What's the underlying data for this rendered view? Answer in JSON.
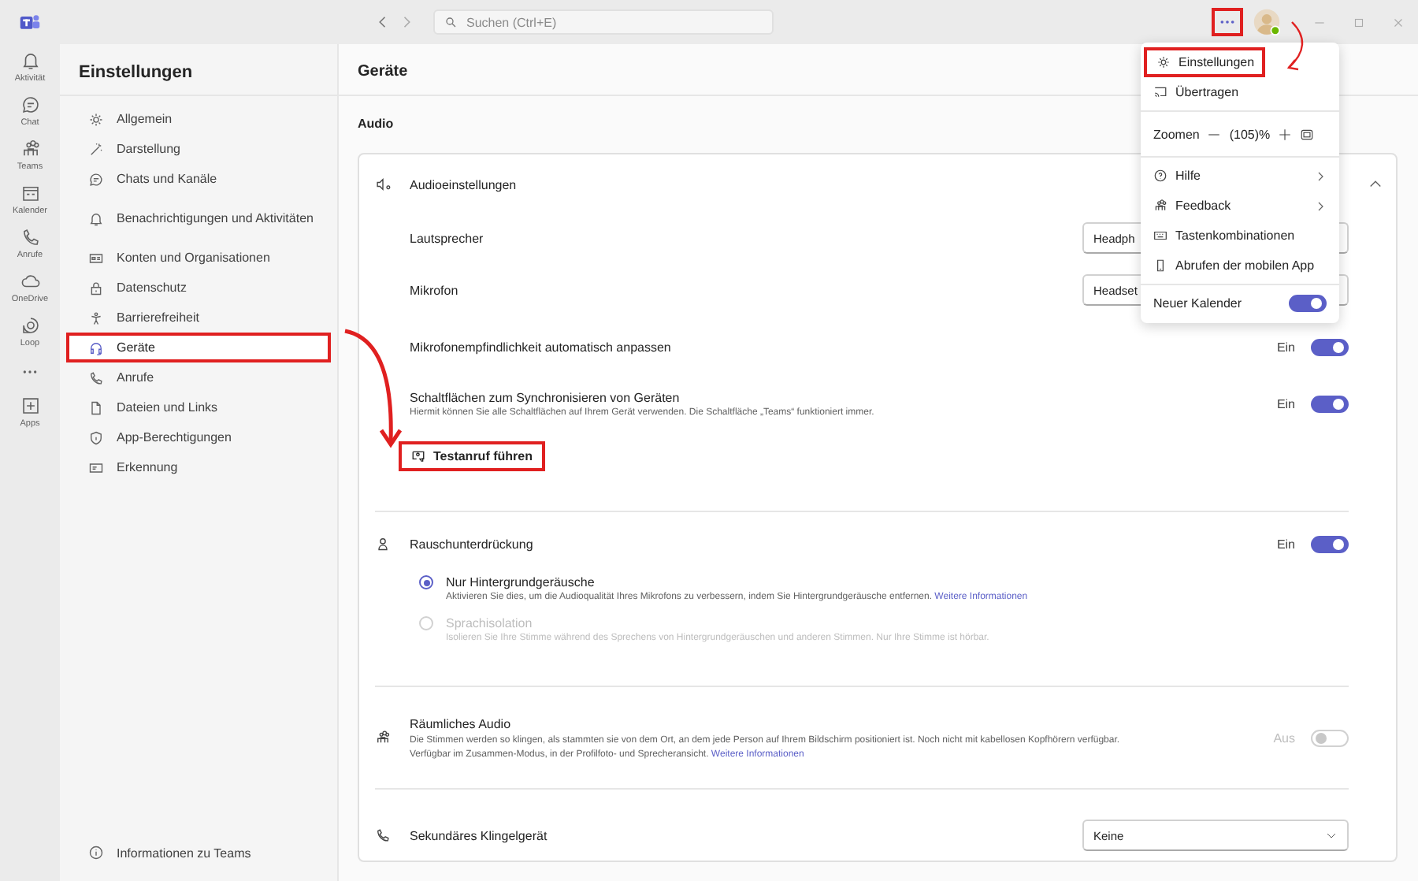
{
  "top_bar": {
    "search": {
      "placeholder": "Suchen (Ctrl+E)"
    },
    "more_button": {
      "highlighted": true
    }
  },
  "app_bar": {
    "items": [
      {
        "kind": "nav",
        "label": "Aktivität"
      },
      {
        "kind": "nav",
        "label": "Chat"
      },
      {
        "kind": "nav",
        "label": "Teams"
      },
      {
        "kind": "nav",
        "label": "Kalender"
      },
      {
        "kind": "nav",
        "label": "Anrufe"
      },
      {
        "kind": "nav",
        "label": "OneDrive"
      },
      {
        "kind": "nav",
        "label": "Loop"
      },
      {
        "kind": "more"
      },
      {
        "kind": "nav",
        "label": "Apps"
      }
    ]
  },
  "settings": {
    "title": "Einstellungen",
    "groups": [
      [
        {
          "label": "Allgemein",
          "selected": false,
          "highlighted": false
        },
        {
          "label": "Darstellung",
          "selected": false,
          "highlighted": false
        },
        {
          "label": "Chats und Kanäle",
          "selected": false,
          "highlighted": false
        }
      ],
      [
        {
          "label": "Benachrichtigungen und Aktivitäten",
          "selected": false,
          "highlighted": false
        }
      ],
      [
        {
          "label": "Konten und Organisationen",
          "selected": false,
          "highlighted": false
        },
        {
          "label": "Datenschutz",
          "selected": false,
          "highlighted": false
        },
        {
          "label": "Barrierefreiheit",
          "selected": false,
          "highlighted": false
        },
        {
          "label": "Geräte",
          "selected": true,
          "highlighted": true
        },
        {
          "label": "Anrufe",
          "selected": false,
          "highlighted": false
        },
        {
          "label": "Dateien und Links",
          "selected": false,
          "highlighted": false
        },
        {
          "label": "App-Berechtigungen",
          "selected": false,
          "highlighted": false
        },
        {
          "label": "Erkennung",
          "selected": false,
          "highlighted": false
        }
      ]
    ],
    "footer": "Informationen zu Teams"
  },
  "page": {
    "title": "Geräte",
    "section": "Audio",
    "audio_settings": {
      "title": "Audioeinstellungen",
      "expanded": true,
      "rows": [
        {
          "kind": "select",
          "label": "Lautsprecher",
          "value": "Headph"
        },
        {
          "kind": "select",
          "label": "Mikrofon",
          "value": "Headset"
        },
        {
          "kind": "toggle",
          "label": "Mikrofonempfindlichkeit automatisch anpassen",
          "state_label": "Ein",
          "on": true
        },
        {
          "kind": "toggle",
          "label": "Schaltflächen zum Synchronisieren von Geräten",
          "description": "Hiermit können Sie alle Schaltflächen auf Ihrem Gerät verwenden. Die Schaltfläche „Teams“ funktioniert immer.",
          "state_label": "Ein",
          "on": true
        }
      ],
      "test_call": {
        "label": "Testanruf führen",
        "highlighted": true
      }
    },
    "noise_suppression": {
      "title": "Rauschunterdrückung",
      "state_label": "Ein",
      "on": true,
      "options": [
        {
          "label": "Nur Hintergrundgeräusche",
          "description": "Aktivieren Sie dies, um die Audioqualität Ihres Mikrofons zu verbessern, indem Sie Hintergrundgeräusche entfernen.",
          "link": "Weitere Informationen",
          "selected": true,
          "disabled": false
        },
        {
          "label": "Sprachisolation",
          "description": "Isolieren Sie Ihre Stimme während des Sprechens von Hintergrundgeräuschen und anderen Stimmen. Nur Ihre Stimme ist hörbar.",
          "selected": false,
          "disabled": true
        }
      ]
    },
    "spatial_audio": {
      "title": "Räumliches Audio",
      "description": "Die Stimmen werden so klingen, als stammten sie von dem Ort, an dem jede Person auf Ihrem Bildschirm positioniert ist. Noch nicht mit kabellosen Kopfhörern verfügbar.",
      "note": "Verfügbar im Zusammen-Modus, in der Profilfoto- und Sprecheransicht.",
      "link": "Weitere Informationen",
      "state_label": "Aus",
      "on": false,
      "disabled": true
    },
    "secondary_ringer": {
      "label": "Sekundäres Klingelgerät",
      "value": "Keine"
    }
  },
  "menu": {
    "items": [
      {
        "kind": "item",
        "label": "Einstellungen",
        "highlighted": true
      },
      {
        "kind": "item",
        "label": "Übertragen",
        "highlighted": false
      },
      {
        "kind": "divider"
      },
      {
        "kind": "zoom",
        "label": "Zoomen",
        "value": "(105)%"
      },
      {
        "kind": "divider"
      },
      {
        "kind": "submenu",
        "label": "Hilfe",
        "highlighted": false
      },
      {
        "kind": "submenu",
        "label": "Feedback",
        "highlighted": false
      },
      {
        "kind": "item",
        "label": "Tastenkombinationen",
        "highlighted": false
      },
      {
        "kind": "item",
        "label": "Abrufen der mobilen App",
        "highlighted": false
      },
      {
        "kind": "divider"
      },
      {
        "kind": "toggle",
        "label": "Neuer Kalender",
        "on": true
      }
    ]
  }
}
